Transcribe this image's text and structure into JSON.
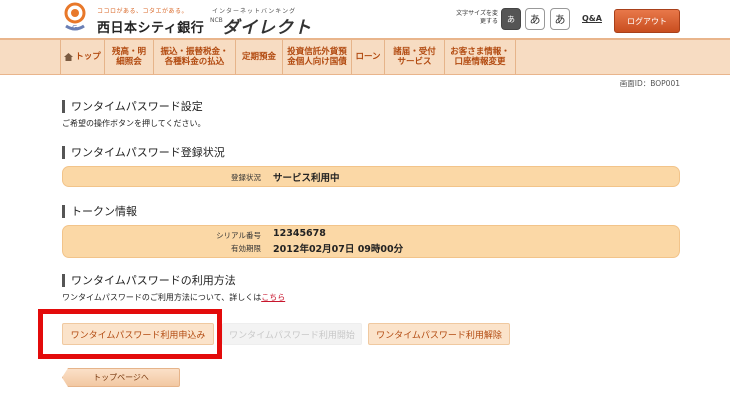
{
  "header": {
    "tagline": "ココロがある、コタエがある。",
    "bank_name": "西日本シティ銀行",
    "direct_sub": "インターネットバンキング",
    "direct_prefix": "NCB",
    "direct_name": "ダイレクト",
    "fontsize_label": "文字サイズを変更する",
    "fontsize_buttons": [
      "あ",
      "あ",
      "あ"
    ],
    "qa_label": "Q&A",
    "logout_label": "ログアウト"
  },
  "nav": {
    "items": [
      {
        "label": "トップ"
      },
      {
        "label": "残高・明細照会"
      },
      {
        "label": "振込・振替税金・各種料金の払込"
      },
      {
        "label": "定期預金"
      },
      {
        "label": "投資信託外貨預金個人向け国債"
      },
      {
        "label": "ローン"
      },
      {
        "label": "諸届・受付サービス"
      },
      {
        "label": "お客さま情報・口座情報変更"
      }
    ]
  },
  "screen_id": "画面ID：BOP001",
  "page": {
    "title": "ワンタイムパスワード設定",
    "instruction": "ご希望の操作ボタンを押してください。"
  },
  "status_section": {
    "title": "ワンタイムパスワード登録状況",
    "label": "登録状況",
    "value": "サービス利用中"
  },
  "token_section": {
    "title": "トークン情報",
    "serial_label": "シリアル番号",
    "serial_value": "12345678",
    "expiry_label": "有効期限",
    "expiry_value": "2012年02月07日 09時00分"
  },
  "usage_section": {
    "title": "ワンタイムパスワードの利用方法",
    "text": "ワンタイムパスワードのご利用方法について、詳しくは",
    "link": "こちら"
  },
  "actions": {
    "apply": "ワンタイムパスワード利用申込み",
    "start": "ワンタイムパスワード利用開始",
    "cancel": "ワンタイムパスワード利用解除",
    "top": "トップページへ"
  },
  "colors": {
    "accent": "#c94e1f",
    "nav_bg": "#f7dcc2",
    "box_bg": "#fbd8a6",
    "highlight": "#e30b0b"
  }
}
